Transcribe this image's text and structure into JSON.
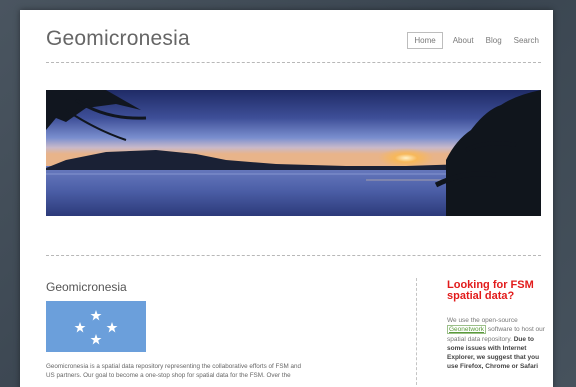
{
  "site": {
    "title": "Geomicronesia"
  },
  "nav": {
    "items": [
      "Home",
      "About",
      "Blog",
      "Search"
    ],
    "active": "Home"
  },
  "main": {
    "heading": "Geomicronesia",
    "intro_line1": "Geomicronesia is a spatial data repository representing the collaborative efforts of FSM and",
    "intro_line2": "US partners.  Our goal to become a one-stop shop for spatial data for the FSM. Over the"
  },
  "sidebar": {
    "title_line1": "Looking for FSM",
    "title_line2": "spatial data?",
    "text_before_link": "We use the open-source",
    "link_label": "Geonetwork",
    "text_after_link": "software to host our spatial data repository.",
    "bold_text": "Due to some issues with Internet Explorer, we suggest that you use Firefox, Chrome or Safari"
  },
  "colors": {
    "accent_red": "#e21b1b",
    "link_green": "#5a9a3a",
    "flag_blue": "#6b9fdb"
  }
}
